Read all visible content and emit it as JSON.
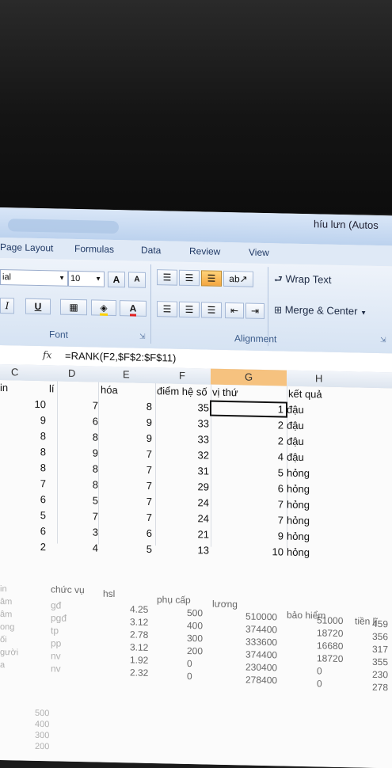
{
  "window": {
    "title": "híu lưn (Autos"
  },
  "ribbon_tabs": [
    "Page Layout",
    "Formulas",
    "Data",
    "Review",
    "View"
  ],
  "toolbar": {
    "font_name": "ial",
    "font_size": "10",
    "grow_font": "A",
    "shrink_font": "A",
    "italic": "I",
    "underline": "U",
    "font_color": "A",
    "wrap_text": "Wrap Text",
    "merge_center": "Merge & Center",
    "group_font": "Font",
    "group_alignment": "Alignment"
  },
  "formula_bar": {
    "fx": "fx",
    "formula": "=RANK(F2,$F$2:$F$11)"
  },
  "columns": [
    "C",
    "D",
    "E",
    "F",
    "G",
    "H"
  ],
  "header_row": [
    "in",
    "lí",
    "hóa",
    "điểm hệ số",
    "vị thứ",
    "kết quả"
  ],
  "rows": [
    [
      "10",
      "7",
      "8",
      "35",
      "1",
      "đậu"
    ],
    [
      "9",
      "6",
      "9",
      "33",
      "2",
      "đậu"
    ],
    [
      "8",
      "8",
      "9",
      "33",
      "2",
      "đậu"
    ],
    [
      "8",
      "9",
      "7",
      "32",
      "4",
      "đậu"
    ],
    [
      "8",
      "8",
      "7",
      "31",
      "5",
      "hỏng"
    ],
    [
      "7",
      "8",
      "7",
      "29",
      "6",
      "hỏng"
    ],
    [
      "6",
      "5",
      "7",
      "24",
      "7",
      "hỏng"
    ],
    [
      "5",
      "7",
      "7",
      "24",
      "7",
      "hỏng"
    ],
    [
      "6",
      "3",
      "6",
      "21",
      "9",
      "hỏng"
    ],
    [
      "2",
      "4",
      "5",
      "13",
      "10",
      "hỏng"
    ]
  ],
  "lower_table": {
    "headers": [
      "chức vụ",
      "hsl",
      "phụ cấp",
      "lương",
      "bảo hiểm",
      "tiền lĩ"
    ],
    "left_labels": [
      "in",
      "âm",
      "âm",
      "ong",
      "ối",
      "gười",
      "a"
    ],
    "rows": [
      [
        "gđ",
        "4.25",
        "500",
        "510000",
        "51000",
        "459"
      ],
      [
        "pgđ",
        "3.12",
        "400",
        "374400",
        "18720",
        "356"
      ],
      [
        "tp",
        "2.78",
        "300",
        "333600",
        "16680",
        "317"
      ],
      [
        "pp",
        "3.12",
        "200",
        "374400",
        "18720",
        "355"
      ],
      [
        "nv",
        "1.92",
        "0",
        "230400",
        "0",
        "230"
      ],
      [
        "nv",
        "2.32",
        "0",
        "278400",
        "0",
        "278"
      ]
    ],
    "far_values": [
      "500",
      "400",
      "300",
      "200"
    ]
  }
}
